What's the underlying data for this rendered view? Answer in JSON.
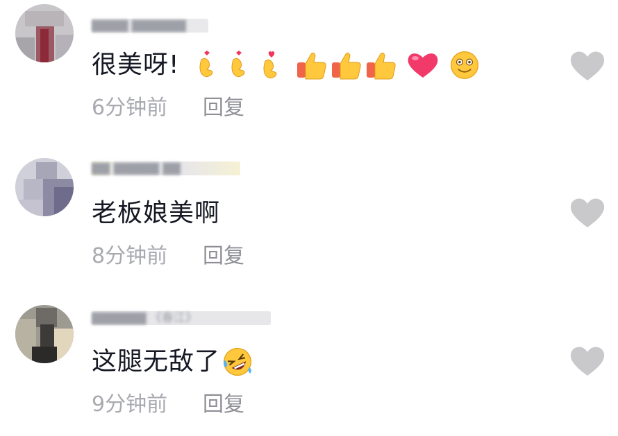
{
  "comments": [
    {
      "username": "▇▇▇▇ ▇▇▇▇▇▇",
      "text": "很美呀!",
      "emojis": [
        "finger-heart-icon",
        "finger-heart-icon",
        "finger-heart-icon",
        "thumbs-up-icon",
        "thumbs-up-icon",
        "thumbs-up-icon",
        "red-heart-icon",
        "smiling-face-icon"
      ],
      "time": "6分钟前",
      "reply": "回复"
    },
    {
      "username": "▇▇ ▇▇▇▇▇ ▇▇",
      "text": "老板娘美啊",
      "emojis": [],
      "time": "8分钟前",
      "reply": "回复"
    },
    {
      "username": "▇▇▇▇▇▇ 《春江》",
      "text": "这腿无敌了",
      "emojis": [
        "rolling-laughing-icon"
      ],
      "time": "9分钟前",
      "reply": "回复"
    }
  ],
  "colors": {
    "text": "#161823",
    "meta": "#a9aab0",
    "like_heart": "#c9c9cc",
    "emoji_yellow": "#ffc83d",
    "emoji_red": "#f0365a"
  }
}
